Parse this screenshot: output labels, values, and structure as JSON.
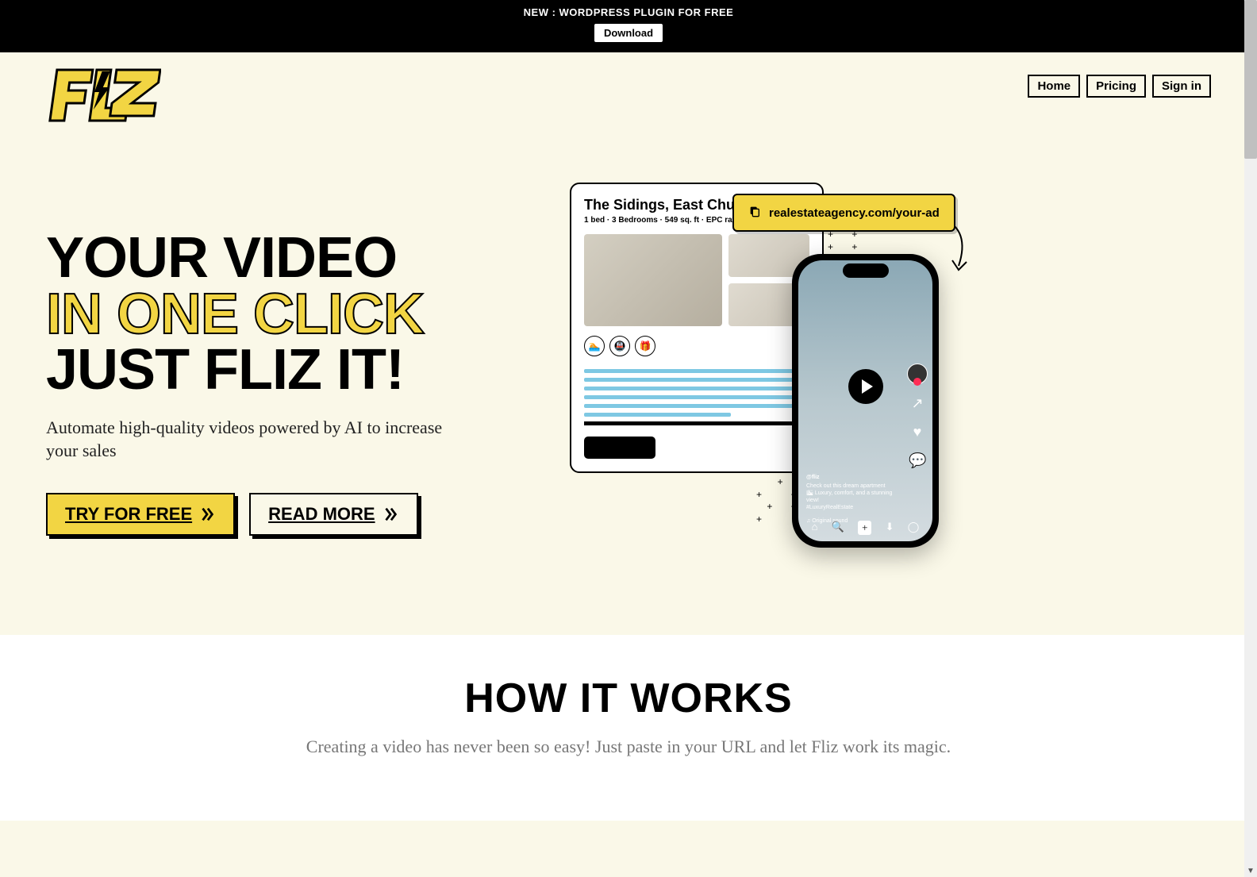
{
  "banner": {
    "text": "NEW : WORDPRESS PLUGIN FOR FREE",
    "button": "Download"
  },
  "nav": {
    "home": "Home",
    "pricing": "Pricing",
    "signin": "Sign in"
  },
  "hero": {
    "title_line1": "YOUR VIDEO",
    "title_line2": "IN ONE CLICK",
    "title_line3": "JUST FLIZ IT!",
    "subtitle": "Automate high-quality videos powered by AI to increase your sales",
    "btn_primary": "TRY FOR FREE",
    "btn_secondary": "READ MORE"
  },
  "listing": {
    "title": "The Sidings, East Church",
    "meta": "1 bed · 3 Bedrooms · 549 sq. ft · EPC rating: A"
  },
  "url_chip": "realestateagency.com/your-ad",
  "phone": {
    "user": "@fliz",
    "caption_line1": "Check out this dream apartment",
    "caption_line2": "🏙 Luxury, comfort, and a stunning view!",
    "caption_line3": "#LuxuryRealEstate",
    "sound": "♫ Original sound"
  },
  "how": {
    "title": "HOW IT WORKS",
    "subtitle": "Creating a video has never been so easy! Just paste in your URL and let Fliz work its magic."
  }
}
